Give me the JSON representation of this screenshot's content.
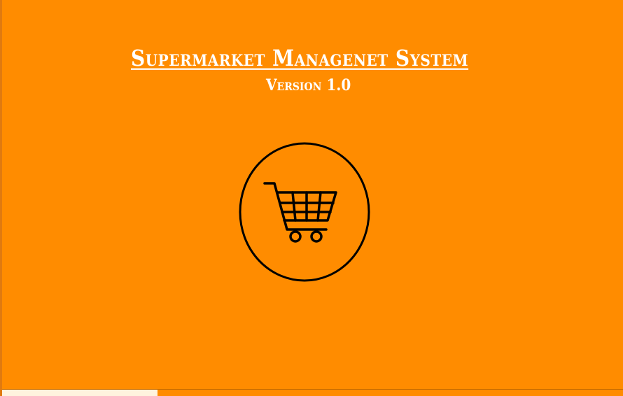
{
  "app": {
    "title": "Supermarket Managenet System",
    "version": "Version 1.0"
  },
  "emblem": {
    "icon": "shopping-cart-icon",
    "stroke_color": "#000000"
  },
  "loading": {
    "progress": 0.25,
    "fill_color": "#fff3de"
  },
  "colors": {
    "background": "#ff8c00",
    "text": "#ffffff"
  }
}
